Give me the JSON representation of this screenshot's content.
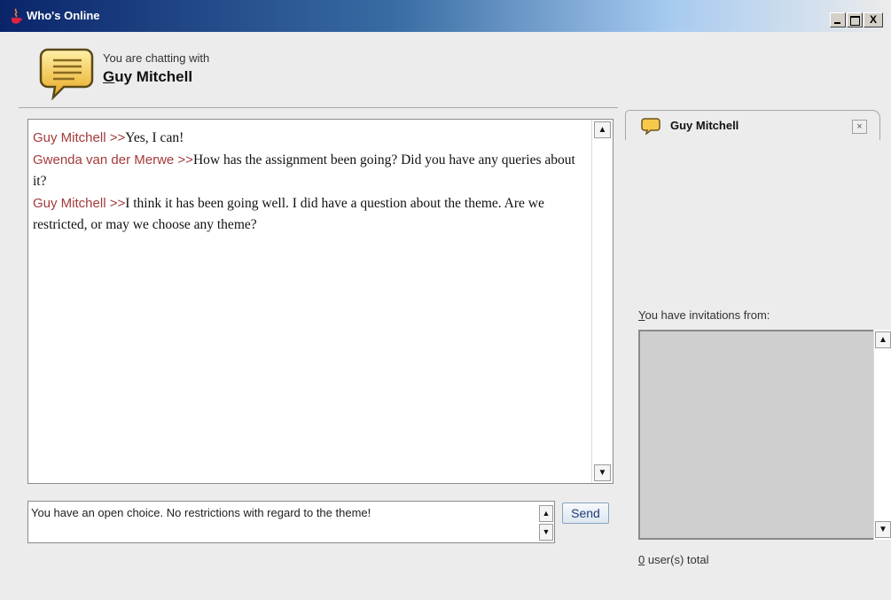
{
  "window": {
    "title": "Who's Online",
    "controls": {
      "minimize": "_",
      "maximize": "□",
      "close": "X"
    }
  },
  "header": {
    "caption": "You are chatting with",
    "contact_name": "Guy Mitchell",
    "icon": "chat-bubble-icon"
  },
  "transcript": {
    "messages": [
      {
        "sender": "Guy Mitchell >>",
        "text": "Yes, I can!"
      },
      {
        "sender": "Gwenda van der Merwe >>",
        "text": "How has the assignment been going? Did you have any queries about it?"
      },
      {
        "sender": "Guy Mitchell >>",
        "text": "I think it has been going well. I did have a question about the theme. Are we restricted, or may we choose any theme?"
      }
    ]
  },
  "composer": {
    "value": "You have an open choice. No restrictions with regard to the theme!",
    "send_label": "Send"
  },
  "tabs": [
    {
      "label": "Guy Mitchell",
      "icon": "chat-bubble-icon",
      "close": "×"
    }
  ],
  "invitations": {
    "label": "You have invitations from:",
    "items": []
  },
  "status": {
    "users_count": "0",
    "users_suffix": " user(s) total"
  },
  "colors": {
    "sender_name": "#a43a3a",
    "title_bar": "#0a246a",
    "bubble_fill": "#f5c94a"
  }
}
